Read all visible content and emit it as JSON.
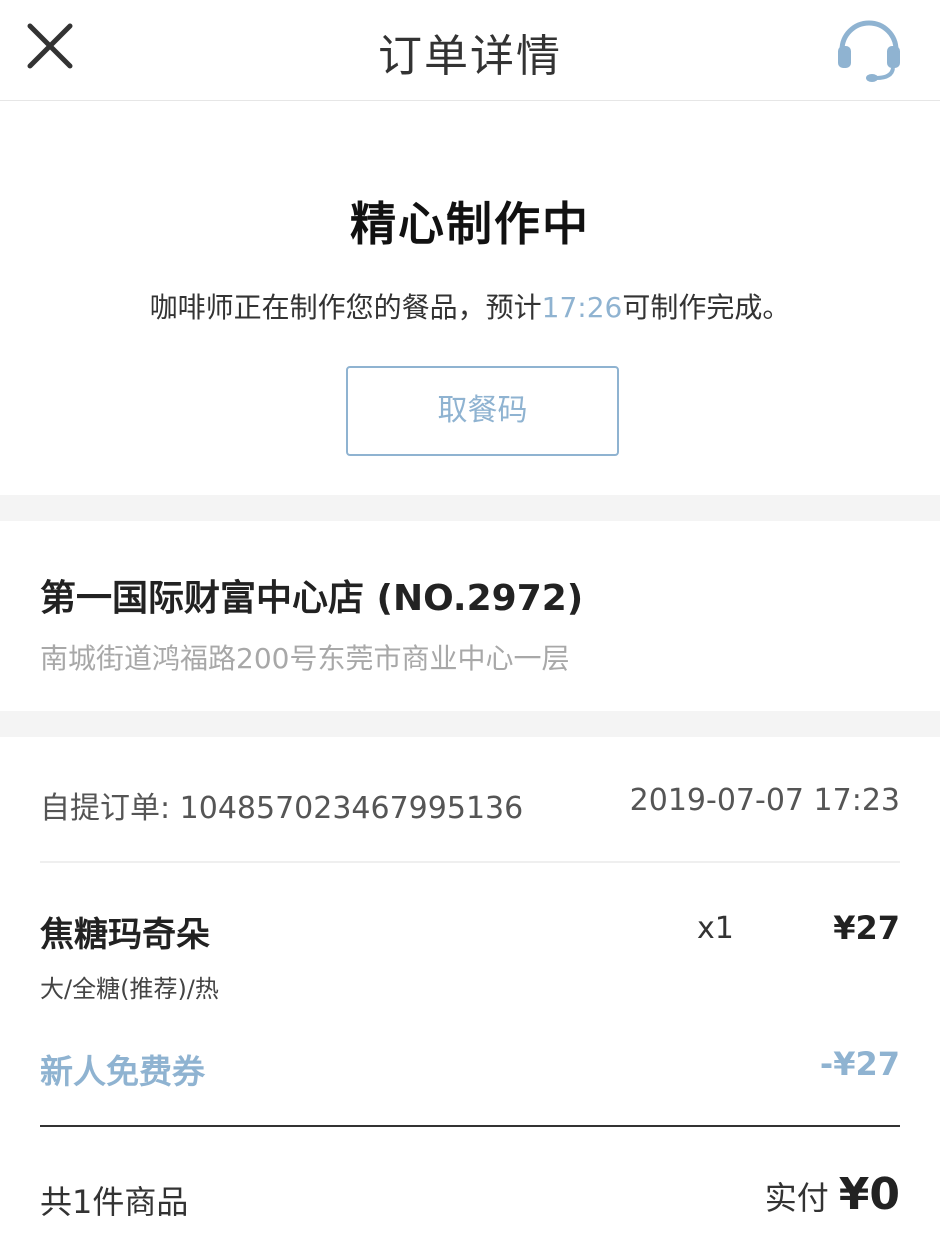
{
  "header": {
    "title": "订单详情"
  },
  "status": {
    "title": "精心制作中",
    "desc_before": "咖啡师正在制作您的餐品，预计",
    "eta_time": "17:26",
    "desc_after": "可制作完成。",
    "pickup_button": "取餐码"
  },
  "store": {
    "name": "第一国际财富中心店 (NO.2972)",
    "address": "南城街道鸿福路200号东莞市商业中心一层"
  },
  "order": {
    "id_label": "自提订单: 104857023467995136",
    "time": "2019-07-07 17:23",
    "item": {
      "name": "焦糖玛奇朵",
      "qty": "x1",
      "price": "¥27",
      "options": "大/全糖(推荐)/热"
    },
    "coupon": {
      "name": "新人免费券",
      "amount": "-¥27"
    },
    "total_count": "共1件商品",
    "paid_label": "实付",
    "paid_amount": "¥0"
  },
  "colors": {
    "accent": "#8fb3d1",
    "background_gap": "#f4f4f4"
  },
  "icons": {
    "close": "close-icon",
    "support": "headset-icon"
  }
}
